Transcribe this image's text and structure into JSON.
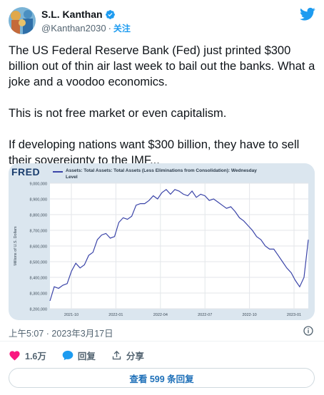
{
  "author": {
    "display_name": "S.L. Kanthan",
    "handle": "@Kanthan2030",
    "separator": "·",
    "follow_label": "关注"
  },
  "tweet": {
    "paragraphs": [
      "The US Federal Reserve Bank (Fed) just printed $300 billion out of thin air last week to bail out the banks. What a joke and a voodoo economics.",
      "This is not free market or even capitalism.",
      "If developing nations want $300 billion, they have to sell their sovereignty to the IMF..."
    ],
    "timestamp": "上午5:07 · 2023年3月17日"
  },
  "actions": {
    "like_count": "1.6万",
    "reply_label": "回复",
    "share_label": "分享"
  },
  "read_replies_label": "查看 599 条回复",
  "colors": {
    "accent": "#1d9bf0",
    "like_red": "#f91880",
    "chart_line": "#3a44a8",
    "chart_bg": "#dbe6ef"
  },
  "chart_data": {
    "type": "line",
    "logo": "FRED",
    "title": "Assets: Total Assets: Total Assets (Less Eliminations from Consolidation): Wednesday Level",
    "ylabel": "Millions of U.S. Dollars",
    "ylim": [
      8200000,
      9000000
    ],
    "y_ticks": [
      "8,200,000",
      "8,300,000",
      "8,400,000",
      "8,500,000",
      "8,600,000",
      "8,700,000",
      "8,800,000",
      "8,900,000",
      "9,000,000"
    ],
    "x_ticks": [
      "2021-10",
      "2022-01",
      "2022-04",
      "2022-07",
      "2022-10",
      "2023-01"
    ],
    "grid": true,
    "series": [
      {
        "x": [
          0,
          0.5,
          1,
          1.5,
          2,
          2.5,
          3,
          3.5,
          4,
          4.5,
          5,
          5.5,
          6,
          6.5,
          7,
          7.5,
          8,
          8.5,
          9,
          9.5,
          10,
          10.5,
          11,
          11.5,
          12,
          12.5,
          13,
          13.5,
          14,
          14.5,
          15,
          15.5,
          16,
          16.5,
          17,
          17.5,
          18,
          18.5,
          19,
          19.5,
          20,
          20.5,
          21,
          21.5,
          22,
          22.5,
          23,
          23.5,
          24,
          24.5,
          25,
          25.5,
          26,
          26.5,
          27,
          27.5,
          28,
          28.5,
          29,
          29.5,
          30
        ],
        "values": [
          8250000,
          8340000,
          8330000,
          8350000,
          8360000,
          8440000,
          8490000,
          8460000,
          8480000,
          8540000,
          8560000,
          8640000,
          8670000,
          8680000,
          8650000,
          8660000,
          8750000,
          8780000,
          8770000,
          8790000,
          8860000,
          8870000,
          8870000,
          8890000,
          8920000,
          8900000,
          8940000,
          8960000,
          8930000,
          8960000,
          8950000,
          8930000,
          8920000,
          8950000,
          8910000,
          8930000,
          8920000,
          8890000,
          8900000,
          8880000,
          8860000,
          8840000,
          8850000,
          8820000,
          8780000,
          8760000,
          8730000,
          8700000,
          8660000,
          8640000,
          8600000,
          8580000,
          8580000,
          8540000,
          8500000,
          8460000,
          8430000,
          8380000,
          8340000,
          8400000,
          8640000
        ]
      }
    ]
  }
}
